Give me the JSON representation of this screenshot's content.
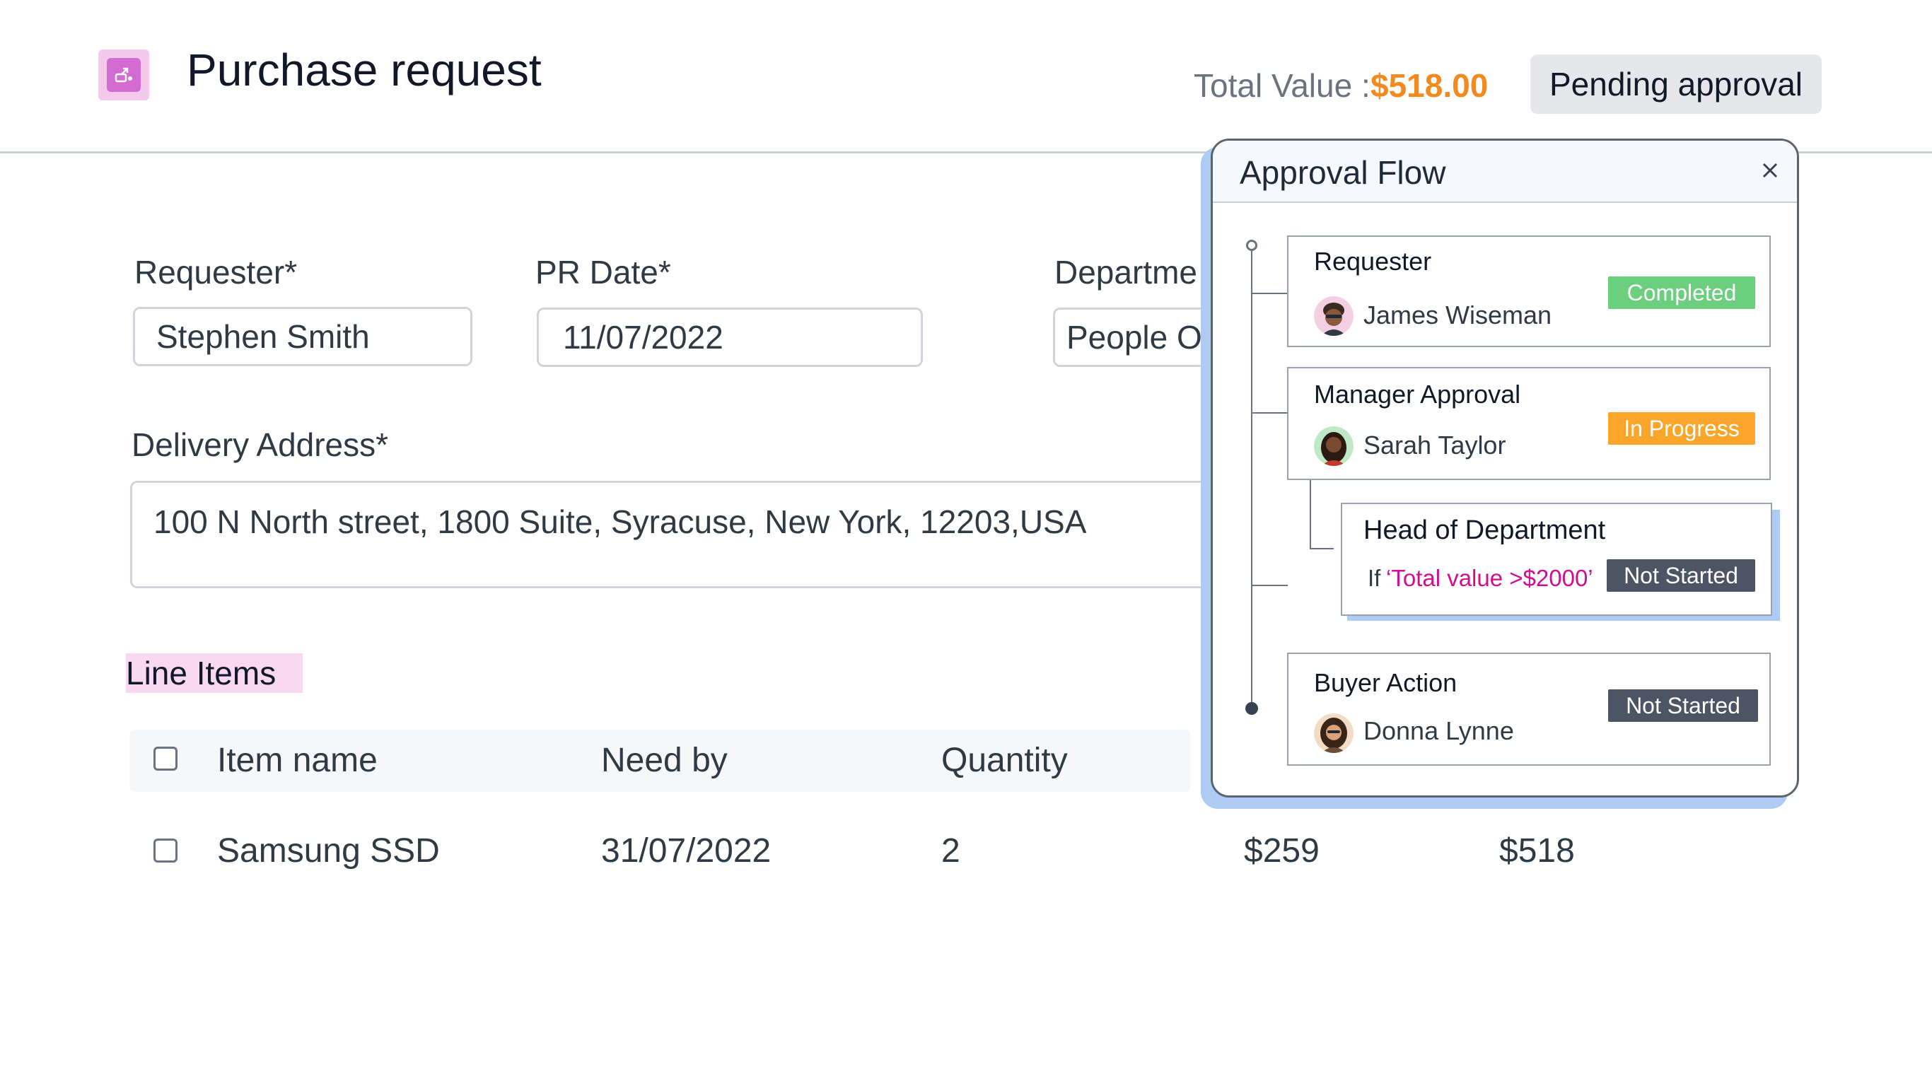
{
  "header": {
    "title": "Purchase request",
    "total_label": "Total Value :",
    "total_value": "$518.00",
    "status": "Pending approval"
  },
  "form": {
    "requester": {
      "label": "Requester*",
      "value": "Stephen Smith"
    },
    "pr_date": {
      "label": "PR Date*",
      "value": "11/07/2022"
    },
    "department": {
      "label": "Departme",
      "value": "People O"
    },
    "delivery_address": {
      "label": "Delivery Address*",
      "value": "100 N North street, 1800 Suite, Syracuse, New York, 12203,USA"
    }
  },
  "line_items": {
    "section_label": "Line Items",
    "columns": [
      "Item name",
      "Need by",
      "Quantity"
    ],
    "rows": [
      {
        "item": "Samsung SSD",
        "need_by": "31/07/2022",
        "quantity": "2",
        "unit_price": "$259",
        "total": "$518"
      }
    ]
  },
  "approval_flow": {
    "title": "Approval Flow",
    "close_icon": "close-icon",
    "steps": [
      {
        "title": "Requester",
        "person": "James Wiseman",
        "status": "Completed"
      },
      {
        "title": "Manager Approval",
        "person": "Sarah Taylor",
        "status": "In Progress"
      },
      {
        "title": "Head of Department",
        "condition_if": "If",
        "condition_expr": "‘Total value >$2000’",
        "status": "Not Started"
      },
      {
        "title": "Buyer Action",
        "person": "Donna Lynne",
        "status": "Not Started"
      }
    ]
  },
  "colors": {
    "accent_orange": "#f28a1f",
    "completed": "#6bcf7d",
    "in_progress": "#f9a62b",
    "not_started": "#4b5563",
    "condition": "#d10f8e",
    "highlight": "#f9d9f1",
    "panel_shadow": "#aecbf3"
  }
}
